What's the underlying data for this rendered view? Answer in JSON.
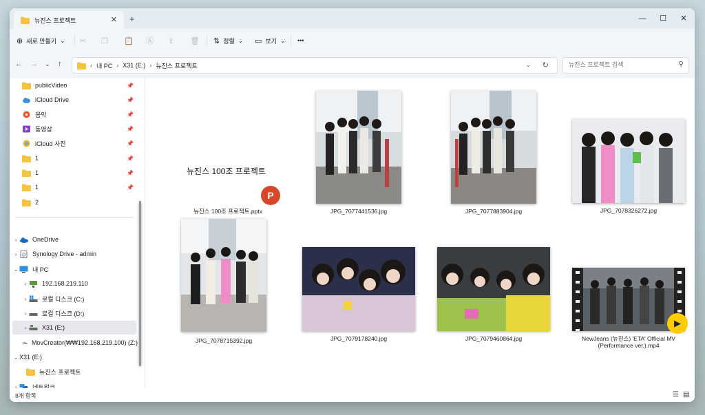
{
  "window": {
    "tab_title": "뉴진스 프로젝트",
    "new_tab": "+",
    "minimize": "—",
    "maximize": "☐",
    "close": "✕"
  },
  "toolbar": {
    "new_label": "새로 만들기",
    "sort_label": "정렬",
    "view_label": "보기",
    "more_label": "•••"
  },
  "address": {
    "crumbs": [
      "내 PC",
      "X31 (E:)",
      "뉴진스 프로젝트"
    ],
    "search_placeholder": "뉴진스 프로젝트 검색"
  },
  "sidebar": {
    "items": [
      {
        "label": "publicVideo",
        "icon": "folder-icon",
        "pinned": true
      },
      {
        "label": "iCloud Drive",
        "icon": "icloud-icon",
        "pinned": true
      },
      {
        "label": "음악",
        "icon": "music-icon",
        "pinned": true
      },
      {
        "label": "동영상",
        "icon": "video-icon",
        "pinned": true
      },
      {
        "label": "iCloud 사진",
        "icon": "photos-icon",
        "pinned": true
      },
      {
        "label": "1",
        "icon": "folder-icon",
        "pinned": true
      },
      {
        "label": "1",
        "icon": "folder-icon",
        "pinned": true
      },
      {
        "label": "1",
        "icon": "folder-icon",
        "pinned": true
      },
      {
        "label": "2",
        "icon": "folder-icon",
        "pinned": false
      },
      {
        "label": "OneDrive",
        "icon": "onedrive-icon"
      },
      {
        "label": "Synology Drive - admin",
        "icon": "synology-icon"
      },
      {
        "label": "내 PC",
        "icon": "pc-icon"
      },
      {
        "label": "192.168.219.110",
        "icon": "network-drive-icon"
      },
      {
        "label": "로컬 디스크 (C:)",
        "icon": "windows-disk-icon"
      },
      {
        "label": "로컬 디스크 (D:)",
        "icon": "disk-icon"
      },
      {
        "label": "X31 (E:)",
        "icon": "usb-drive-icon"
      },
      {
        "label": "MovCreator(₩₩192.168.219.100) (Z:)",
        "icon": "network-drive-icon"
      },
      {
        "label": "X31 (E:)",
        "icon": "usb-drive-icon"
      },
      {
        "label": "뉴진스 프로젝트",
        "icon": "folder-icon"
      },
      {
        "label": "네트워크",
        "icon": "network-icon"
      }
    ]
  },
  "files": [
    {
      "name": "뉴진스 100조 프로젝트.pptx",
      "preview_title": "뉴진스 100조 프로젝트",
      "badge": "P",
      "type": "pptx"
    },
    {
      "name": "JPG_7077441536.jpg",
      "type": "jpg"
    },
    {
      "name": "JPG_7077883904.jpg",
      "type": "jpg"
    },
    {
      "name": "JPG_7078326272.jpg",
      "type": "jpg"
    },
    {
      "name": "JPG_7078715392.jpg",
      "type": "jpg"
    },
    {
      "name": "JPG_7079178240.jpg",
      "type": "jpg"
    },
    {
      "name": "JPG_7079460864.jpg",
      "type": "jpg"
    },
    {
      "name_line1": "NewJeans (뉴진스) 'ETA' Official MV",
      "name_line2": "(Performance ver.).mp4",
      "type": "mp4"
    }
  ],
  "status": {
    "count": "8개 항목"
  },
  "colors": {
    "accent": "#005fb8",
    "folder": "#f5c342",
    "pptx": "#d9472b",
    "play": "#ffcc00"
  }
}
